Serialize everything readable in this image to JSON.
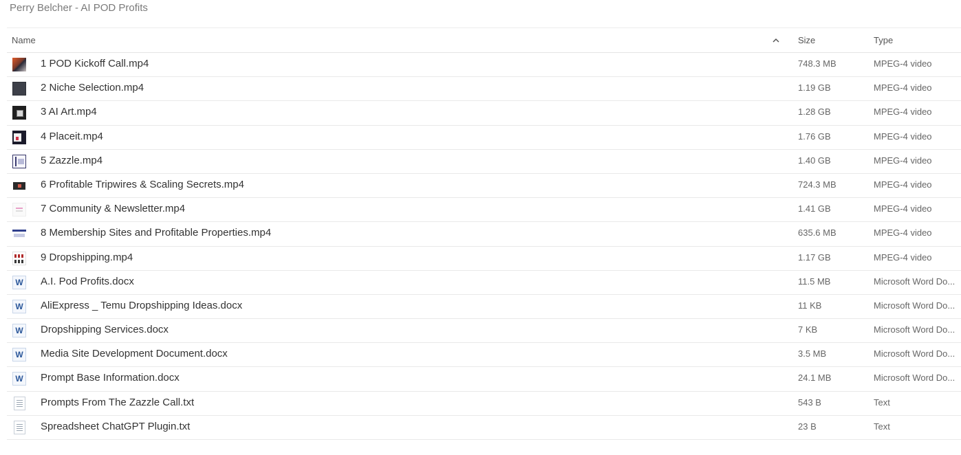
{
  "window": {
    "title": "Perry Belcher - AI POD Profits"
  },
  "columns": {
    "name": "Name",
    "size": "Size",
    "type": "Type",
    "sort_icon": "chevron-up-icon"
  },
  "files": [
    {
      "name": "1 POD Kickoff Call.mp4",
      "size": "748.3 MB",
      "type": "MPEG-4 video",
      "icon": "video-thumbnail-icon"
    },
    {
      "name": "2 Niche Selection.mp4",
      "size": "1.19 GB",
      "type": "MPEG-4 video",
      "icon": "video-thumbnail-icon"
    },
    {
      "name": "3 AI Art.mp4",
      "size": "1.28 GB",
      "type": "MPEG-4 video",
      "icon": "video-thumbnail-icon"
    },
    {
      "name": "4 Placeit.mp4",
      "size": "1.76 GB",
      "type": "MPEG-4 video",
      "icon": "video-thumbnail-icon"
    },
    {
      "name": "5 Zazzle.mp4",
      "size": "1.40 GB",
      "type": "MPEG-4 video",
      "icon": "video-thumbnail-icon"
    },
    {
      "name": "6 Profitable Tripwires & Scaling Secrets.mp4",
      "size": "724.3 MB",
      "type": "MPEG-4 video",
      "icon": "video-thumbnail-icon"
    },
    {
      "name": "7 Community & Newsletter.mp4",
      "size": "1.41 GB",
      "type": "MPEG-4 video",
      "icon": "video-thumbnail-icon"
    },
    {
      "name": "8 Membership Sites and Profitable Properties.mp4",
      "size": "635.6 MB",
      "type": "MPEG-4 video",
      "icon": "video-thumbnail-icon"
    },
    {
      "name": "9 Dropshipping.mp4",
      "size": "1.17 GB",
      "type": "MPEG-4 video",
      "icon": "video-thumbnail-icon"
    },
    {
      "name": "A.I. Pod Profits.docx",
      "size": "11.5 MB",
      "type": "Microsoft Word Do...",
      "icon": "word-document-icon",
      "icon_letter": "W"
    },
    {
      "name": "AliExpress _ Temu Dropshipping Ideas.docx",
      "size": "11 KB",
      "type": "Microsoft Word Do...",
      "icon": "word-document-icon",
      "icon_letter": "W"
    },
    {
      "name": "Dropshipping Services.docx",
      "size": "7 KB",
      "type": "Microsoft Word Do...",
      "icon": "word-document-icon",
      "icon_letter": "W"
    },
    {
      "name": "Media Site Development Document.docx",
      "size": "3.5 MB",
      "type": "Microsoft Word Do...",
      "icon": "word-document-icon",
      "icon_letter": "W"
    },
    {
      "name": "Prompt Base Information.docx",
      "size": "24.1 MB",
      "type": "Microsoft Word Do...",
      "icon": "word-document-icon",
      "icon_letter": "W"
    },
    {
      "name": "Prompts From The Zazzle Call.txt",
      "size": "543 B",
      "type": "Text",
      "icon": "text-file-icon"
    },
    {
      "name": "Spreadsheet ChatGPT Plugin.txt",
      "size": "23 B",
      "type": "Text",
      "icon": "text-file-icon"
    }
  ]
}
